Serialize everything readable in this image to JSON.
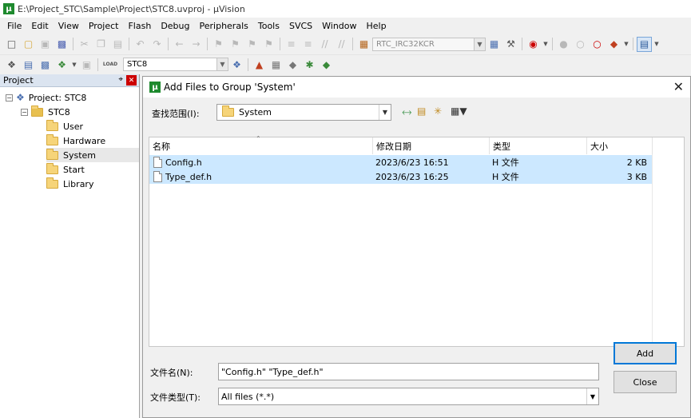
{
  "window": {
    "title": "E:\\Project_STC\\Sample\\Project\\STC8.uvproj - µVision",
    "app_icon": "µ"
  },
  "menu": [
    "File",
    "Edit",
    "View",
    "Project",
    "Flash",
    "Debug",
    "Peripherals",
    "Tools",
    "SVCS",
    "Window",
    "Help"
  ],
  "toolbar1": {
    "device_combo": "RTC_IRC32KCR"
  },
  "toolbar2": {
    "load_label": "LOAD",
    "target_combo": "STC8"
  },
  "project_pane": {
    "title": "Project",
    "pin": "⌖",
    "close": "✕",
    "tree": [
      {
        "label": "Project: STC8",
        "expander": "−"
      },
      {
        "label": "STC8",
        "expander": "−"
      },
      {
        "label": "User"
      },
      {
        "label": "Hardware"
      },
      {
        "label": "System"
      },
      {
        "label": "Start"
      },
      {
        "label": "Library"
      }
    ]
  },
  "dialog": {
    "title": "Add Files to Group 'System'",
    "close": "✕",
    "look_in_label": "查找范围(I):",
    "look_in_value": "System",
    "columns": [
      "名称",
      "修改日期",
      "类型",
      "大小"
    ],
    "files": [
      {
        "name": "Config.h",
        "modified": "2023/6/23 16:51",
        "type": "H 文件",
        "size": "2 KB"
      },
      {
        "name": "Type_def.h",
        "modified": "2023/6/23 16:25",
        "type": "H 文件",
        "size": "3 KB"
      }
    ],
    "filename_label": "文件名(N):",
    "filename_value": "\"Config.h\" \"Type_def.h\"",
    "filetype_label": "文件类型(T):",
    "filetype_value": "All files (*.*)",
    "add_button": "Add",
    "close_button": "Close"
  }
}
